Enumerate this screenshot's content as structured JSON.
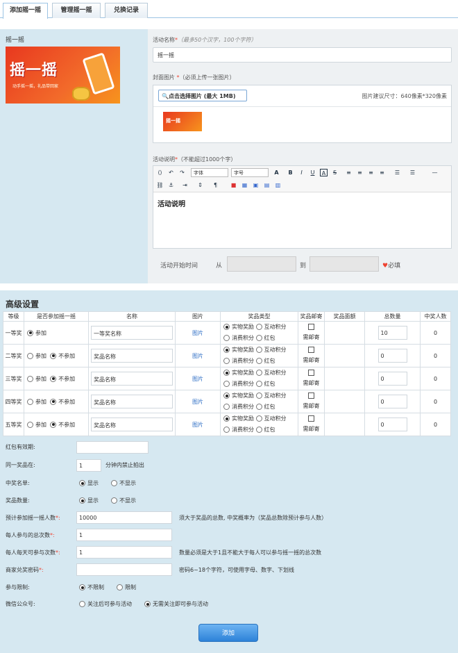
{
  "tabs": [
    "添加摇一摇",
    "管理摇一摇",
    "兑换记录"
  ],
  "left": {
    "title": "摇一摇",
    "banner_text": "摇一摇",
    "banner_sub": "动手摇一摇，礼品带回家"
  },
  "form": {
    "name_label": "活动名称",
    "name_hint": "（最多50个汉字，100个字符）",
    "name_value": "摇一摇",
    "cover_label": "封面图片",
    "cover_hint": "（必须上传一张图片）",
    "cover_button": "点击选择图片 (最大 1MB)",
    "cover_size_hint": "图片建议尺寸：640像素*320像素",
    "desc_label": "活动说明",
    "desc_hint": "（不能超过1000个字）",
    "editor_font": "字体",
    "editor_size": "字号",
    "editor_content": "活动说明",
    "time_label": "活动开始时间",
    "time_from": "从",
    "time_to": "到",
    "time_required": "必填"
  },
  "advanced": {
    "title": "高级设置",
    "headers": [
      "等级",
      "是否参加摇一摇",
      "名称",
      "图片",
      "奖品类型",
      "奖品邮寄",
      "奖品面额",
      "总数量",
      "中奖人数"
    ],
    "join_label": "参加",
    "notjoin_label": "不参加",
    "image_link": "图片",
    "types": [
      "实物奖励",
      "互动积分",
      "消费积分",
      "红包"
    ],
    "mail_label": "需邮寄",
    "rows": [
      {
        "level": "一等奖",
        "name": "一等奖名称",
        "qty": "10",
        "winners": "0",
        "join": true
      },
      {
        "level": "二等奖",
        "name": "奖品名称",
        "qty": "0",
        "winners": "0",
        "join": false
      },
      {
        "level": "三等奖",
        "name": "奖品名称",
        "qty": "0",
        "winners": "0",
        "join": false
      },
      {
        "level": "四等奖",
        "name": "奖品名称",
        "qty": "0",
        "winners": "0",
        "join": false
      },
      {
        "level": "五等奖",
        "name": "奖品名称",
        "qty": "0",
        "winners": "0",
        "join": false
      }
    ]
  },
  "settings": {
    "redpacket_label": "红包有效期:",
    "same_prize_label": "同一奖品在:",
    "same_prize_value": "1",
    "same_prize_suffix": "分钟内禁止拍出",
    "winners_list_label": "中奖名单:",
    "prize_count_label": "奖品数量:",
    "show": "显示",
    "hide": "不显示",
    "expected_label": "预计参加摇一摇人数",
    "expected_value": "10000",
    "expected_hint": "须大于奖品的总数, 中奖概率为（奖品总数除预计参与人数）",
    "per_person_label": "每人参与的总次数",
    "per_person_value": "1",
    "per_day_label": "每人每天可参与次数",
    "per_day_value": "1",
    "per_day_hint": "数量必须是大于1且不能大于每人可以参与摇一摇的总次数",
    "redeem_label": "商家兑奖密码",
    "redeem_hint": "密码6~18个字符，可使用字母、数字、下划线",
    "limit_label": "参与限制:",
    "no_limit": "不限制",
    "limit": "限制",
    "wechat_label": "微信公众号:",
    "follow_join": "关注后可参与活动",
    "no_follow_join": "无需关注即可参与活动",
    "submit": "添加"
  },
  "colors": {
    "accent": "#2d82d8",
    "required": "#e43333",
    "panel": "#d6e8f1"
  }
}
